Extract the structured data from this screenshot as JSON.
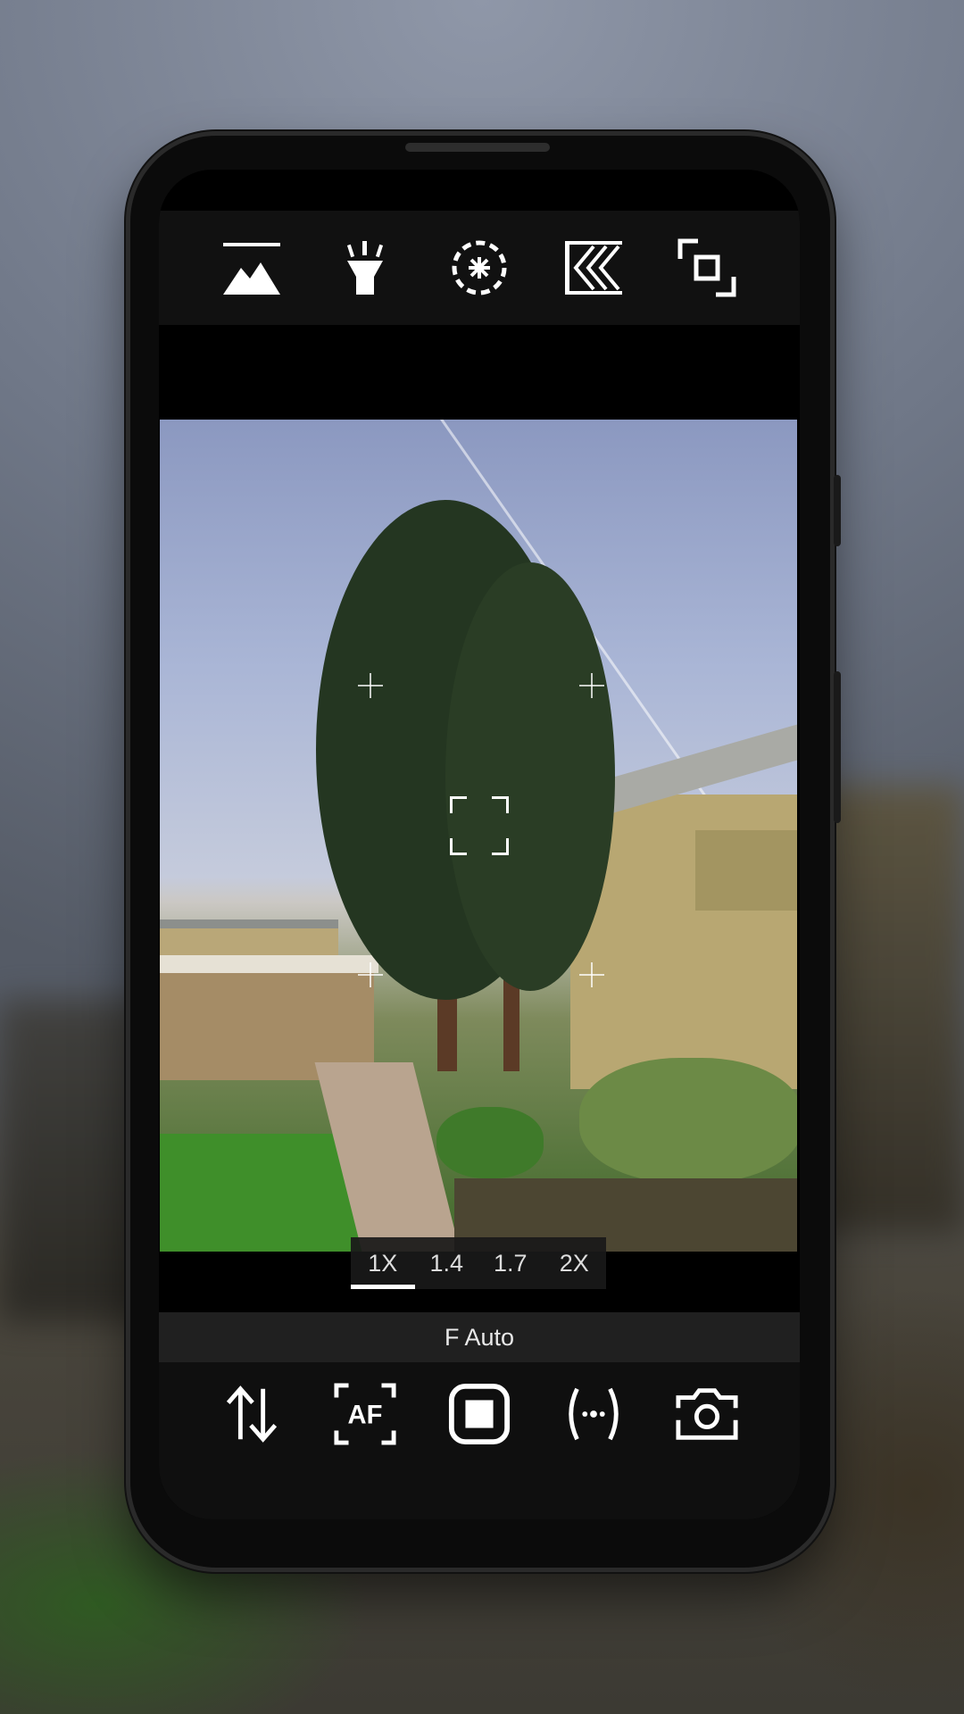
{
  "top_toolbar": {
    "icons": [
      "landscape-icon",
      "flashlight-icon",
      "exposure-icon",
      "shutter-speed-icon",
      "frame-icon"
    ]
  },
  "viewfinder": {
    "focus_indicator": "focus-box-icon",
    "grid_markers": "crosshair-icon"
  },
  "zoom": {
    "levels": [
      "1X",
      "1.4",
      "1.7",
      "2X"
    ],
    "active": "1X"
  },
  "f_bar": {
    "label": "F Auto"
  },
  "bottom_toolbar": {
    "icons": [
      "swap-icon",
      "autofocus-icon",
      "record-stop-icon",
      "stabilization-icon",
      "switch-camera-icon"
    ]
  },
  "colors": {
    "bar_background": "#111111",
    "icon_color": "#ffffff",
    "f_bar_background": "#202020"
  }
}
